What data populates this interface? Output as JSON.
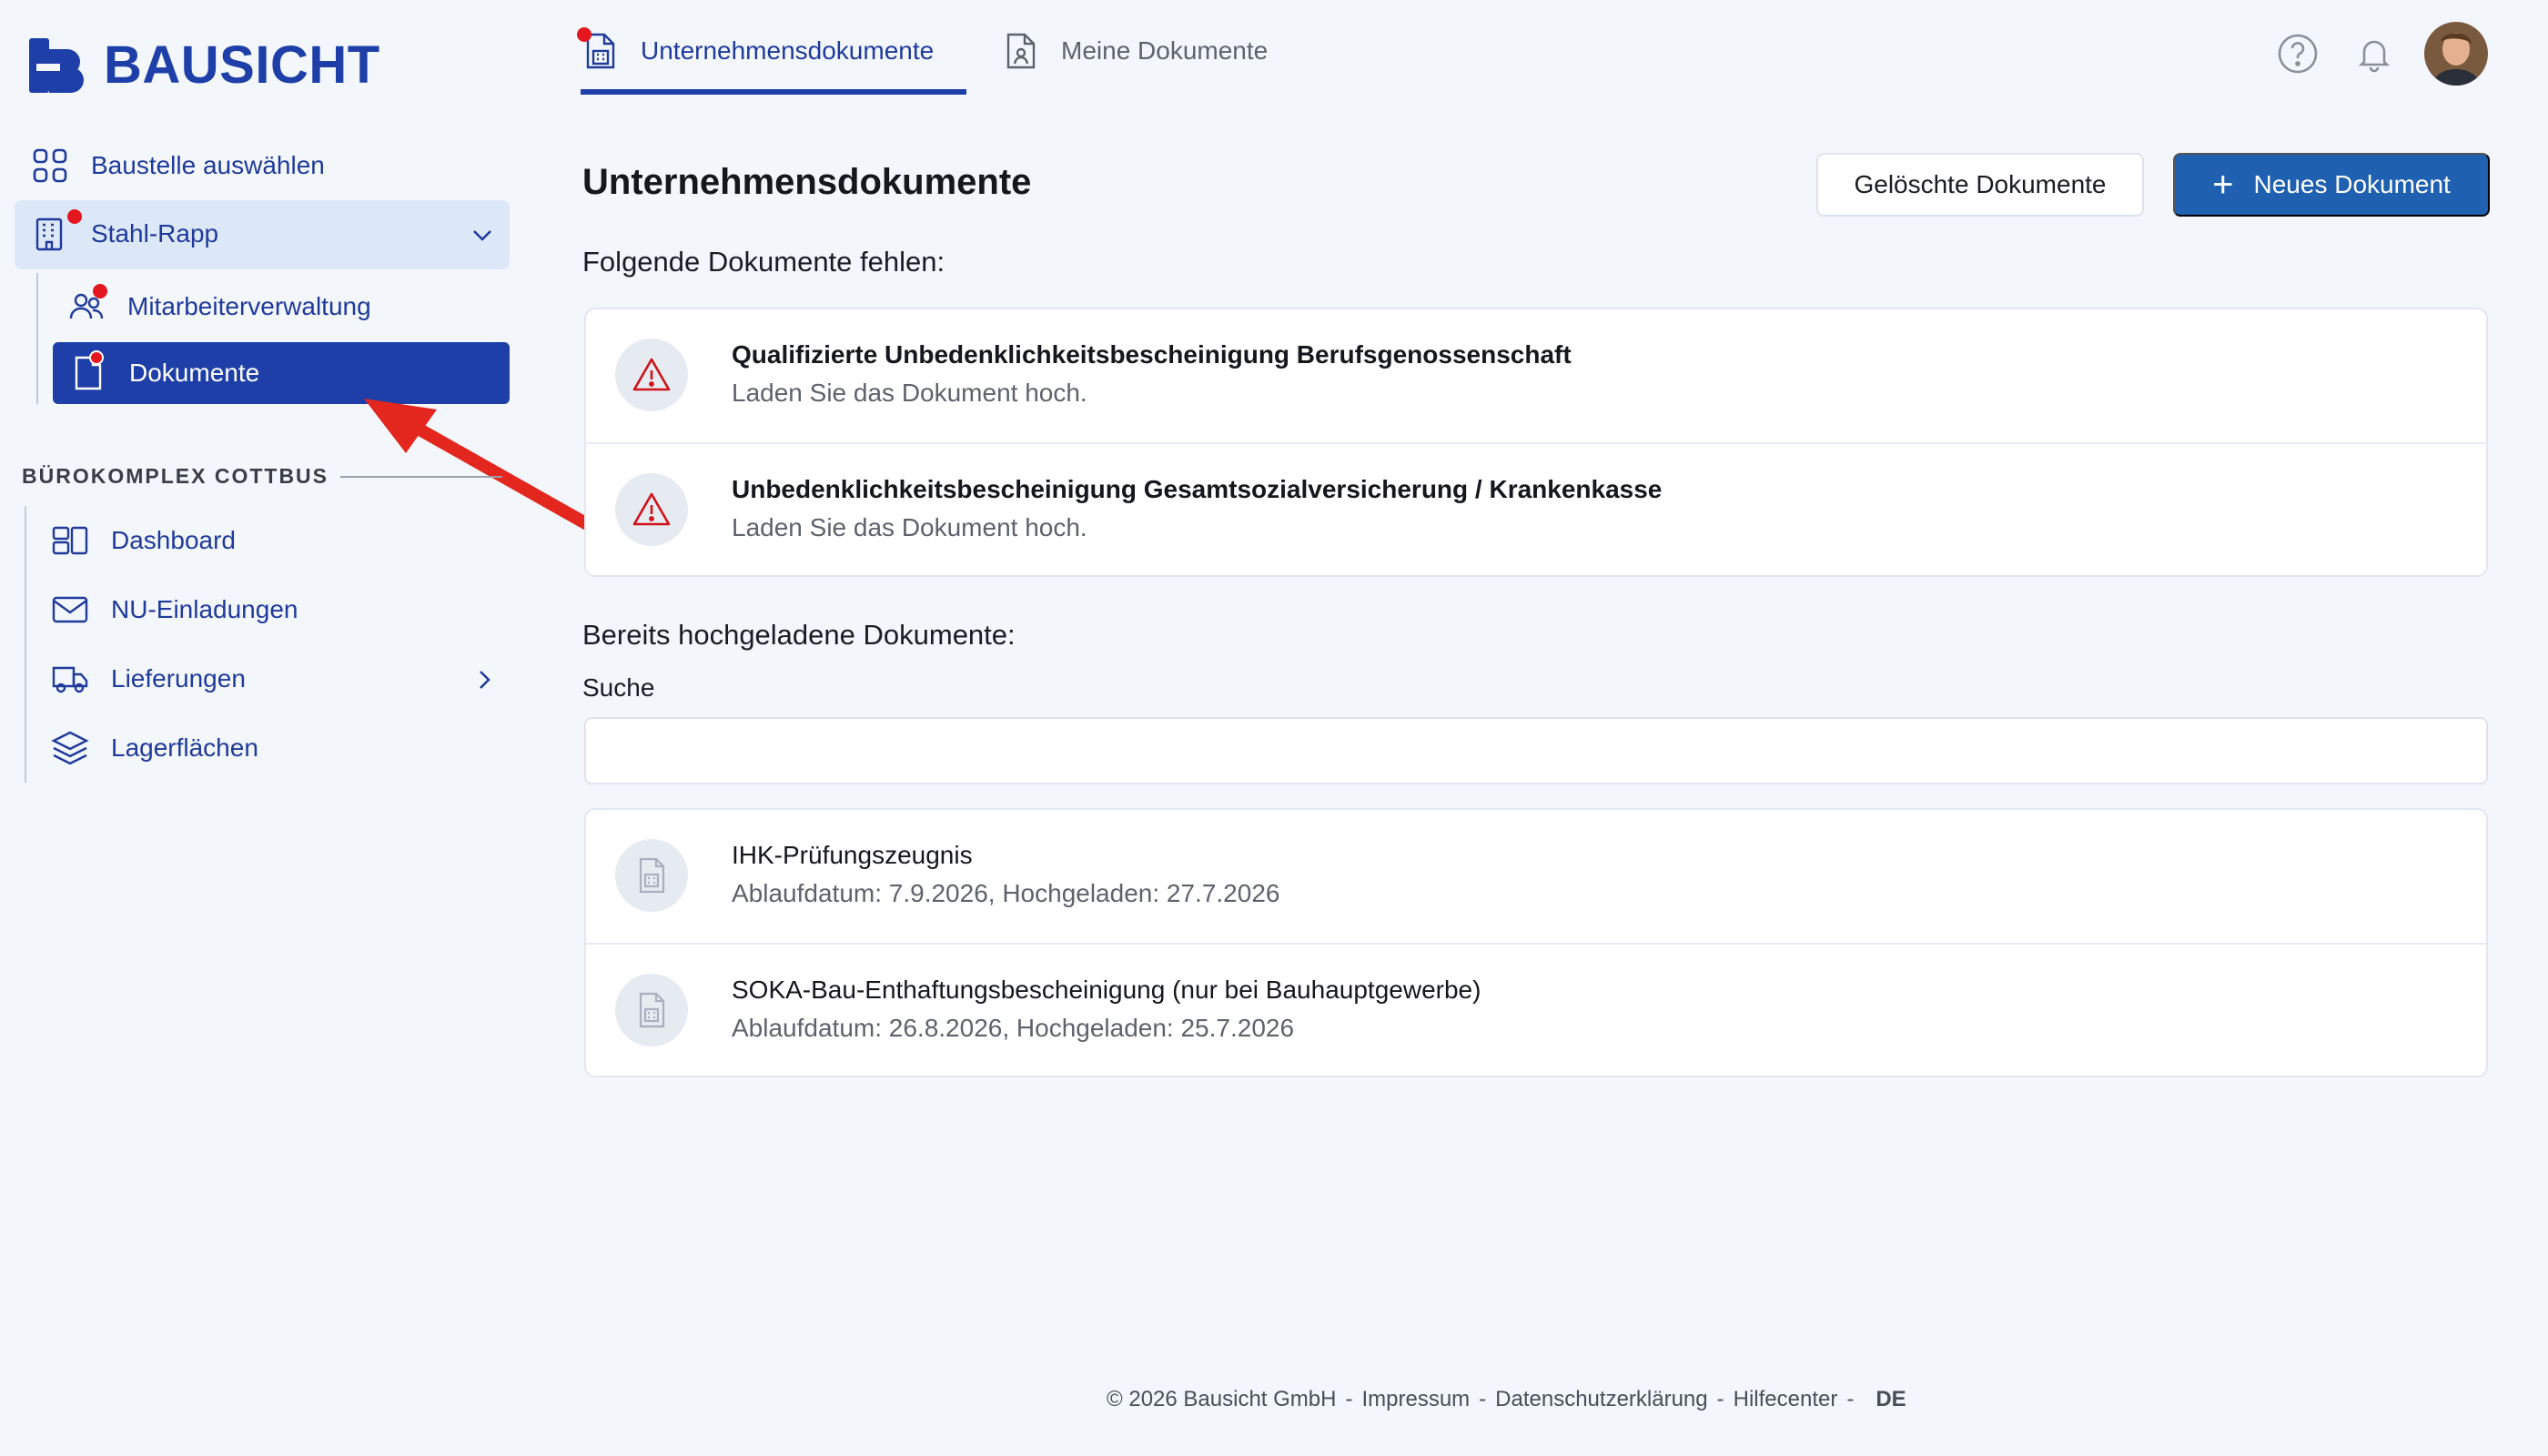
{
  "app": {
    "brand": "BAUSICHT",
    "accent": "#1f3fa8",
    "primary_button": "#1f60b0",
    "alert": "#e4161e"
  },
  "sidebar": {
    "select_site": {
      "label": "Baustelle auswählen",
      "icon": "grid-icon"
    },
    "current_site": {
      "label": "Stahl-Rapp",
      "icon": "building-icon",
      "has_notification": true
    },
    "site_items": [
      {
        "label": "Mitarbeiterverwaltung",
        "icon": "users-icon",
        "has_notification": true
      },
      {
        "label": "Dokumente",
        "icon": "document-icon",
        "has_notification": true,
        "active": true
      }
    ],
    "section": {
      "title": "BÜROKOMPLEX COTTBUS",
      "items": [
        {
          "label": "Dashboard",
          "icon": "dashboard-icon"
        },
        {
          "label": "NU-Einladungen",
          "icon": "mail-icon"
        },
        {
          "label": "Lieferungen",
          "icon": "truck-icon",
          "has_submenu": true
        },
        {
          "label": "Lagerflächen",
          "icon": "layers-icon"
        }
      ]
    }
  },
  "tabs": [
    {
      "label": "Unternehmensdokumente",
      "active": true,
      "has_notification": true
    },
    {
      "label": "Meine Dokumente",
      "active": false
    }
  ],
  "header_icons": [
    "help-icon",
    "bell-icon",
    "avatar"
  ],
  "main": {
    "title": "Unternehmensdokumente",
    "deleted_button": "Gelöschte Dokumente",
    "new_button": "Neues Dokument",
    "missing_heading": "Folgende Dokumente fehlen:",
    "missing": [
      {
        "title": "Qualifizierte Unbedenklichkeitsbescheinigung Berufsgenossenschaft",
        "subtitle": "Laden Sie das Dokument hoch."
      },
      {
        "title": "Unbedenklichkeitsbescheinigung Gesamtsozialversicherung / Krankenkasse",
        "subtitle": "Laden Sie das Dokument hoch."
      }
    ],
    "uploaded_heading": "Bereits hochgeladene Dokumente:",
    "search_label": "Suche",
    "search_value": "",
    "uploaded": [
      {
        "title": "IHK-Prüfungszeugnis",
        "subtitle": "Ablaufdatum: 7.9.2026, Hochgeladen: 27.7.2026"
      },
      {
        "title": "SOKA-Bau-Enthaftungsbescheinigung (nur bei Bauhauptgewerbe)",
        "subtitle": "Ablaufdatum: 26.8.2026, Hochgeladen: 25.7.2026"
      }
    ]
  },
  "footer": {
    "copyright": "© 2026 Bausicht GmbH",
    "sep": "-",
    "links": [
      "Impressum",
      "Datenschutzerklärung",
      "Hilfecenter"
    ],
    "language": "DE"
  }
}
